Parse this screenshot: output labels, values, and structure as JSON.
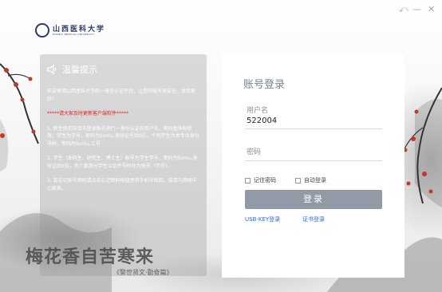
{
  "window": {
    "back_glyph": "⤺",
    "minimize_glyph": "—",
    "close_glyph": "✕"
  },
  "logo": {
    "cn": "山西医科大学",
    "en": "SHANXI MEDICAL UNIVERSITY"
  },
  "notice": {
    "title": "温馨提示",
    "paragraphs": [
      "欢迎使用山西医科大学统一身份认证平台，让您的账号更安全，体验更好！",
      "*****请大家及时更新客户端软件*****",
      "1. 新生使用前请先登录账号进行一身份认证的用户名、密码查询和修改，学生为学号，密码为Sxmu.身份证号后6位，个别学生为本专业身份号码，密码为Sxmu.工号",
      "2. 学生（本科生、研究生、博士生）账号为学生学号，密码为Sxmu.身份证后6位，有少数部分学生以证件号码作为账号（学号）。",
      "3. 若忘记账号密码请点击忘记密码按钮使用手机号找回，或请与网络中心联系。"
    ]
  },
  "poem": {
    "text": "梅花香自苦寒来",
    "source": "《警世贤文·勤奋篇》"
  },
  "login": {
    "title": "账号登录",
    "username_label": "用户名",
    "username_value": "522004",
    "password_placeholder": "密码",
    "remember_label": "记住密码",
    "auto_login_label": "自动登录",
    "submit_label": "登录",
    "usb_key_link": "USB-KEY登录",
    "cert_link": "证书登录"
  },
  "colors": {
    "accent_blue": "#2b6cd4",
    "button_gray": "#919aa6",
    "warning_red": "#e61f1f",
    "blossom_red": "#c0392b"
  }
}
